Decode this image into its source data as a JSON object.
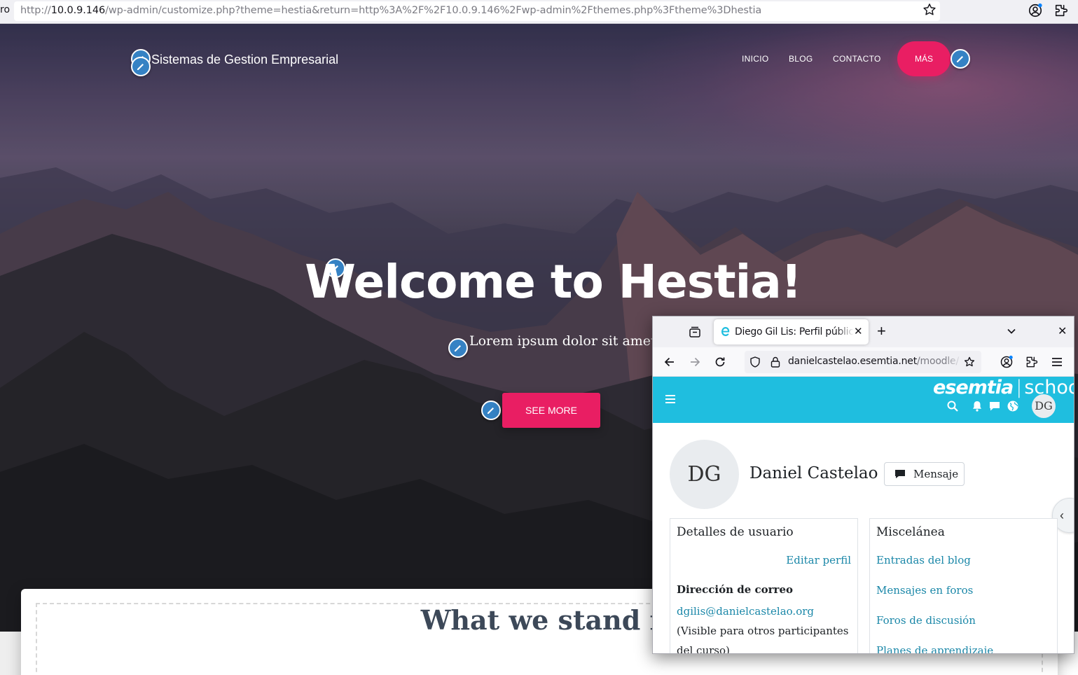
{
  "browser": {
    "left_fragment": "ro",
    "url_prefix": "http://",
    "url_host": "10.0.9.146",
    "url_path": "/wp-admin/customize.php?theme=hestia&return=http%3A%2F%2F10.0.9.146%2Fwp-admin%2Fthemes.php%3Ftheme%3Dhestia",
    "icons": [
      "star-icon",
      "account-icon",
      "extensions-icon"
    ]
  },
  "site": {
    "brand": "Sistemas de Gestion Empresarial",
    "nav": [
      "INICIO",
      "BLOG",
      "CONTACTO"
    ],
    "nav_highlight": "MÁS",
    "hero_title": "Welcome to Hestia!",
    "hero_subtitle": "Lorem ipsum dolor sit amet",
    "hero_button": "SEE MORE",
    "section_title": "What we stand fo",
    "accent_color": "#e91e63",
    "edit_shortcut_color": "#3582c4"
  },
  "popup": {
    "tab_title": "Diego Gil Lis: Perfil público",
    "url_host": "danielcastelao.esemtia.net",
    "url_path": "/moodle/",
    "logo_brand": "esemtia",
    "logo_suffix": "school",
    "user_initials": "DG",
    "profile_initials": "DG",
    "profile_name": "Daniel Castelao",
    "message_button": "Mensaje",
    "details": {
      "heading": "Detalles de usuario",
      "edit_link": "Editar perfil",
      "email_label": "Dirección de correo",
      "email": "dgilis@danielcastelao.org",
      "email_note": " (Visible para otros participantes del curso)"
    },
    "misc": {
      "heading": "Miscelánea",
      "links": [
        "Entradas del blog",
        "Mensajes en foros",
        "Foros de discusión",
        "Planes de aprendizaje"
      ]
    },
    "header_color": "#1fbedf"
  }
}
